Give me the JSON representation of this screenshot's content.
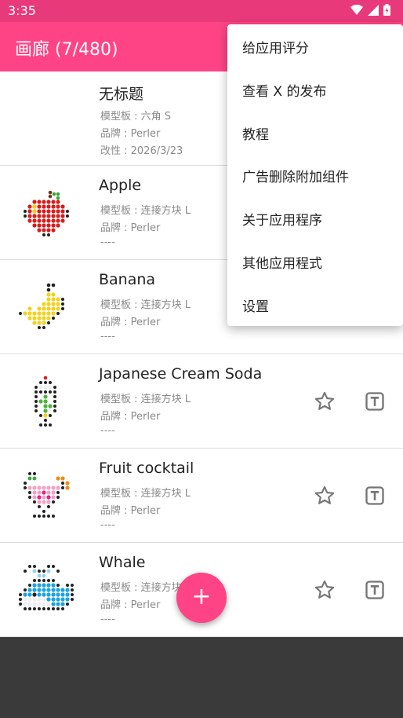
{
  "status_bar": {
    "time": "3:35"
  },
  "app_bar": {
    "title": "画廊 (7/480)"
  },
  "items": [
    {
      "name": "无标题",
      "template": "模型板 : 六角 S",
      "brand": "品牌 : Perler",
      "modified": "改性 : 2026/3/23"
    },
    {
      "name": "Apple",
      "template": "模型板 : 连接方块 L",
      "brand": "品牌 : Perler",
      "modified": "----"
    },
    {
      "name": "Banana",
      "template": "模型板 : 连接方块 L",
      "brand": "品牌 : Perler",
      "modified": "----"
    },
    {
      "name": "Japanese Cream Soda",
      "template": "模型板 : 连接方块 L",
      "brand": "品牌 : Perler",
      "modified": "----"
    },
    {
      "name": "Fruit cocktail",
      "template": "模型板 : 连接方块 L",
      "brand": "品牌 : Perler",
      "modified": "----"
    },
    {
      "name": "Whale",
      "template": "模型板 : 连接方块 L",
      "brand": "品牌 : Perler",
      "modified": "----"
    }
  ],
  "fab": {
    "label": "+"
  },
  "menu": {
    "items": [
      "给应用评分",
      "查看 X 的发布",
      "教程",
      "广告删除附加组件",
      "关于应用程序",
      "其他应用程式",
      "设置"
    ]
  },
  "colors": {
    "primary": "#ff4485",
    "status": "#e83a7a",
    "bottom": "#3a3a3a"
  },
  "icons": [
    "wifi-icon",
    "signal-icon",
    "battery-icon",
    "star-icon",
    "text-tool-icon",
    "add-icon"
  ]
}
